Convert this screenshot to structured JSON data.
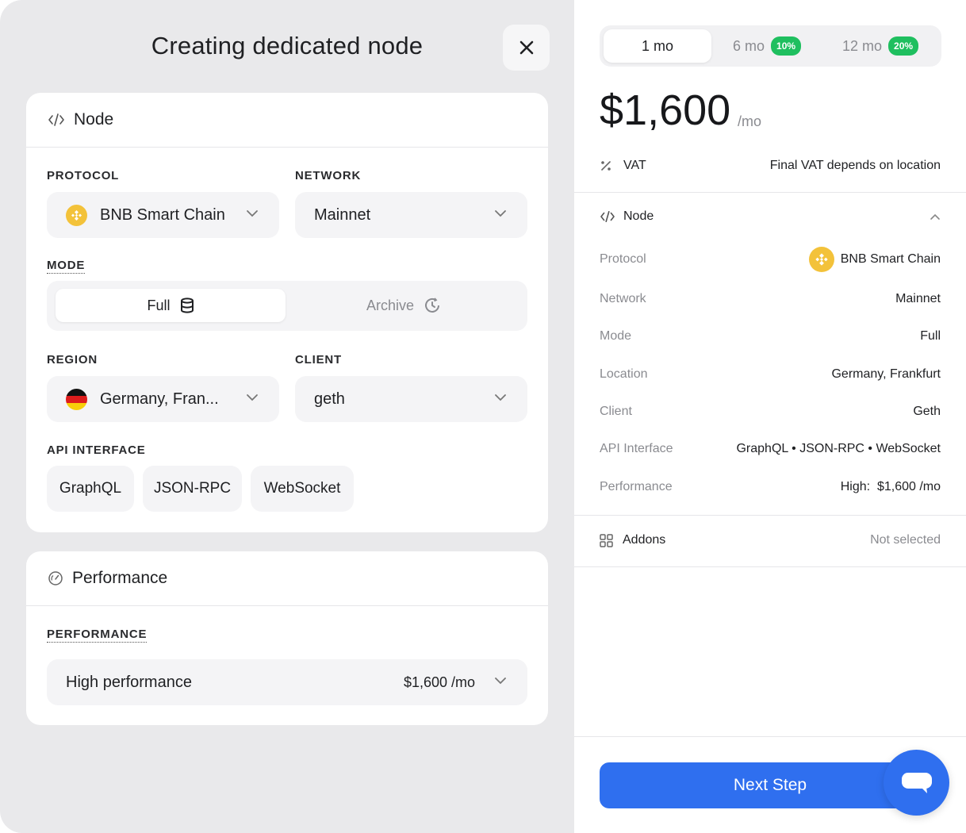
{
  "header": {
    "title": "Creating dedicated node"
  },
  "node_card": {
    "title": "Node",
    "protocol_label": "PROTOCOL",
    "protocol_value": "BNB Smart Chain",
    "network_label": "NETWORK",
    "network_value": "Mainnet",
    "mode_label": "MODE",
    "mode_options": [
      "Full",
      "Archive"
    ],
    "mode_selected": "Full",
    "region_label": "REGION",
    "region_value": "Germany, Fran...",
    "client_label": "CLIENT",
    "client_value": "geth",
    "api_label": "API INTERFACE",
    "api_chips": [
      "GraphQL",
      "JSON-RPC",
      "WebSocket"
    ]
  },
  "performance_card": {
    "title": "Performance",
    "label": "PERFORMANCE",
    "value": "High performance",
    "price": "$1,600 /mo"
  },
  "summary": {
    "periods": [
      {
        "label": "1 mo",
        "badge": ""
      },
      {
        "label": "6 mo",
        "badge": "10%"
      },
      {
        "label": "12 mo",
        "badge": "20%"
      }
    ],
    "price": "$1,600",
    "per": "/mo",
    "vat_label": "VAT",
    "vat_value": "Final VAT depends on location",
    "node_section": "Node",
    "details": [
      {
        "k": "Protocol",
        "v": "BNB Smart Chain"
      },
      {
        "k": "Network",
        "v": "Mainnet"
      },
      {
        "k": "Mode",
        "v": "Full"
      },
      {
        "k": "Location",
        "v": "Germany, Frankfurt"
      },
      {
        "k": "Client",
        "v": "Geth"
      },
      {
        "k": "API Interface",
        "v": "GraphQL • JSON-RPC • WebSocket"
      },
      {
        "k": "Performance",
        "v": "High:  $1,600 /mo"
      }
    ],
    "addons_label": "Addons",
    "addons_value": "Not selected",
    "next_button": "Next Step"
  },
  "colors": {
    "accent": "#2f6fef",
    "badge": "#1fbf5f",
    "bnb": "#f3c23a"
  },
  "icons": [
    "close-icon",
    "code-icon",
    "chevron-down-icon",
    "database-icon",
    "history-icon",
    "gauge-icon",
    "percent-icon",
    "chevron-up-icon",
    "grid-icon",
    "chat-icon",
    "bnb-icon",
    "germany-flag-icon"
  ]
}
